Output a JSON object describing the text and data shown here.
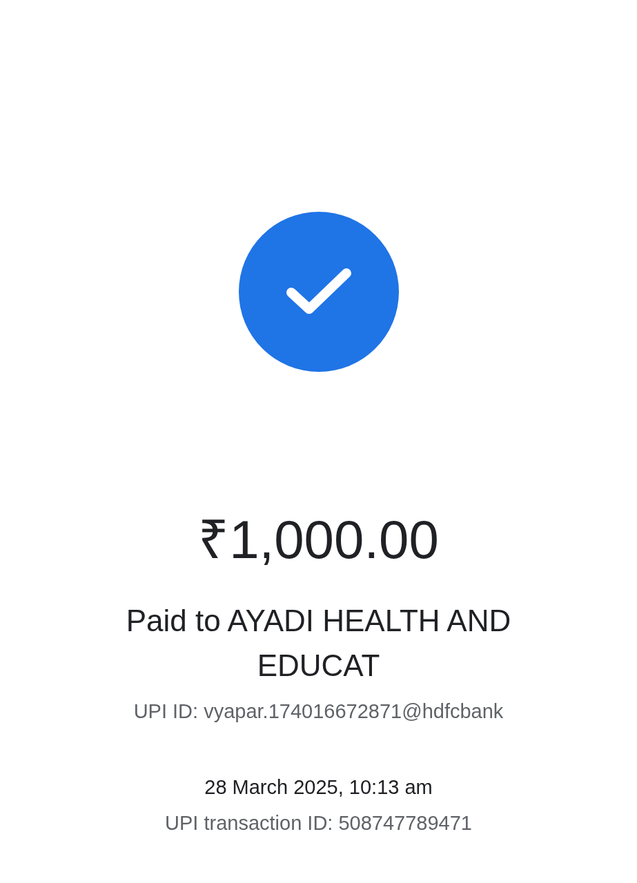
{
  "status": {
    "kind": "success"
  },
  "amount": "₹1,000.00",
  "payee": "Paid to AYADI HEALTH AND EDUCAT",
  "upi_id": "UPI ID: vyapar.174016672871@hdfcbank",
  "datetime": "28 March 2025, 10:13 am",
  "transaction_id": "UPI transaction ID: 508747789471"
}
